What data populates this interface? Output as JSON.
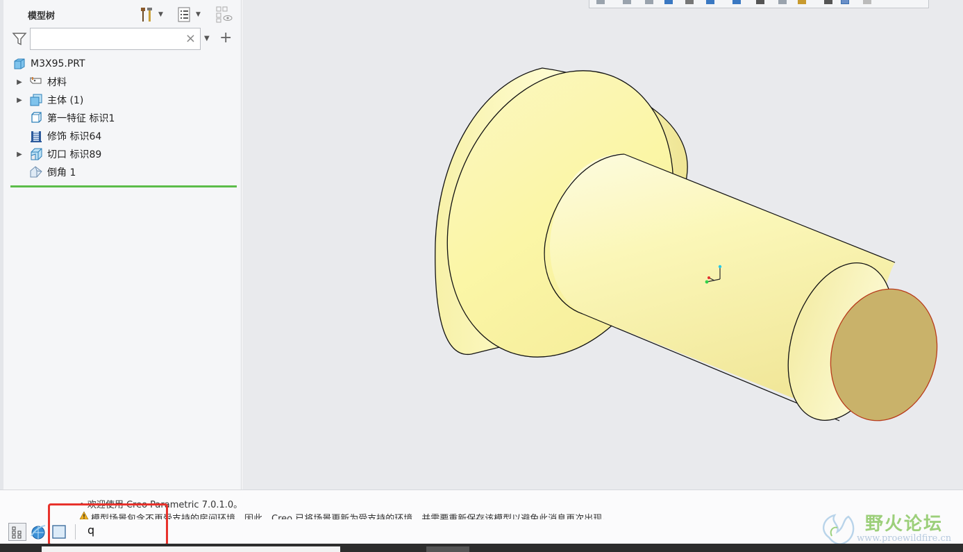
{
  "model_tree": {
    "title": "模型树",
    "search_placeholder": "",
    "items": [
      {
        "label": "M3X95.PRT",
        "icon": "part-icon",
        "expandable": false
      },
      {
        "label": "材料",
        "icon": "material-tag-icon",
        "expandable": true
      },
      {
        "label": "主体 (1)",
        "icon": "body-icon",
        "expandable": true
      },
      {
        "label": "第一特征 标识1",
        "icon": "first-feature-icon",
        "expandable": false
      },
      {
        "label": "修饰 标识64",
        "icon": "cosmetic-thread-icon",
        "expandable": false
      },
      {
        "label": "切口 标识89",
        "icon": "cut-icon",
        "expandable": true
      },
      {
        "label": "倒角 1",
        "icon": "chamfer-icon",
        "expandable": false
      }
    ]
  },
  "messages": {
    "info": "欢迎使用 Creo Parametric 7.0.1.0。",
    "warning": "模型场景包含不再受支持的房间环境。因此，Creo 已将场景更新为受支持的环境，并需要重新保存该模型以避免此消息再次出现。"
  },
  "command_input": {
    "value": "q"
  },
  "watermark": {
    "title": "野火论坛",
    "url": "www.proewildfire.cn"
  },
  "colors": {
    "model_body": "#fbf6b8",
    "cut_face": "#c9b26a",
    "edge": "#111111",
    "highlight_box": "#e8322c",
    "tree_end_line": "#5cbd4a",
    "viewport_bg": "#e9eaed"
  }
}
